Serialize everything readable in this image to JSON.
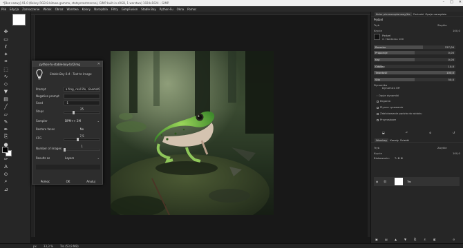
{
  "window": {
    "title": "*[Bez nazwy]-91.0 (Kolory RGB 8-bitowa gamma, statsprzestrzenna), GIMP built-in sRGB, 1 warstwa) 1024x1024 – GIMP",
    "controls": [
      "–",
      "□",
      "✕"
    ]
  },
  "menu": [
    "Plik",
    "Edycja",
    "Zaznaczenie",
    "Widok",
    "Obraz",
    "Warstwa",
    "Kolory",
    "Narzędzia",
    "Filtry",
    "GimpFusion",
    "Stable Boy",
    "Python-Fu",
    "Okna",
    "Pomoc"
  ],
  "toolbox": {
    "icons": [
      "move-icon",
      "rect-select-icon",
      "lasso-icon",
      "fuzzy-select-icon",
      "crop-icon",
      "unified-transform-icon",
      "warp-icon",
      "cage-icon",
      "bucket-fill-icon",
      "gradient-icon",
      "paintbrush-icon",
      "eraser-icon",
      "airbrush-icon",
      "ink-icon",
      "clone-icon",
      "smudge-icon",
      "dodge-icon",
      "path-icon",
      "text-icon",
      "color-picker-icon",
      "zoom-icon",
      "measure-icon"
    ],
    "fg_color": "#000000",
    "bg_color": "#ffffff"
  },
  "dialog": {
    "title": "python-fu-stable-boy-txt2img",
    "subtitle": "Stable Boy 0.4 - Text to Image",
    "fields": {
      "prompt_label": "Prompt",
      "prompt_value": "a frog, real life, cinematic",
      "negative_label": "Negative prompt",
      "negative_value": "",
      "seed_label": "Seed",
      "seed_value": "-1",
      "steps_label": "Steps",
      "steps_value": "25",
      "steps_fraction": 0.25,
      "sampler_label": "Sampler",
      "sampler_value": "DPM++ 2M",
      "restore_label": "Restore faces",
      "restore_value": "No",
      "cfg_label": "CFG",
      "cfg_value": "7,5",
      "cfg_fraction": 0.375,
      "images_label": "Number of images",
      "images_value": "1",
      "images_fraction": 0.0,
      "results_label": "Results as",
      "results_value": "Layers"
    },
    "buttons": {
      "help": "Pomoc",
      "ok": "OK",
      "cancel": "Anuluj"
    }
  },
  "right_dock": {
    "top_tabs": [
      "Kolor pierwszoplanowy/tła",
      "Czcionki",
      "Opcje narzędzia"
    ],
    "tool_title": "Pędzel",
    "mode_label": "Tryb",
    "mode_value": "Zwykle",
    "opacity_label": "Krycie",
    "opacity_value": "100,0",
    "brush_label": "Pędzel",
    "brush_name": "2. Hardness 100",
    "sliders": [
      {
        "label": "Rozmiar",
        "value": "127,00",
        "fraction": 0.6
      },
      {
        "label": "Proporcje",
        "value": "0,00",
        "fraction": 0.5
      },
      {
        "label": "Kąt",
        "value": "0,00",
        "fraction": 0.5
      },
      {
        "label": "Odstęp",
        "value": "10,0",
        "fraction": 0.1
      },
      {
        "label": "Twardość",
        "value": "100,0",
        "fraction": 1.0
      },
      {
        "label": "Siła",
        "value": "50,0",
        "fraction": 0.5
      }
    ],
    "dynamics_label": "Dynamika",
    "dynamics_value": "Dynamics Off",
    "options": [
      "Opcje dynamiki",
      "Drgania",
      "Płynne rysowanie",
      "Zablokowanie pędzla do widoku",
      "Przyrostowe"
    ],
    "layers_tabs": [
      "Warstwy",
      "Kanały",
      "Ścieżki"
    ],
    "layers_mode_label": "Tryb",
    "layers_mode_value": "Zwykle",
    "layers_opacity_label": "Krycie",
    "layers_opacity_value": "100,0",
    "lock_label": "Blokowanie:",
    "layer_name": "Tło"
  },
  "status": {
    "unit": "px",
    "zoom": "33,3 %",
    "layer_info": "Tło (53,9 MB)"
  }
}
